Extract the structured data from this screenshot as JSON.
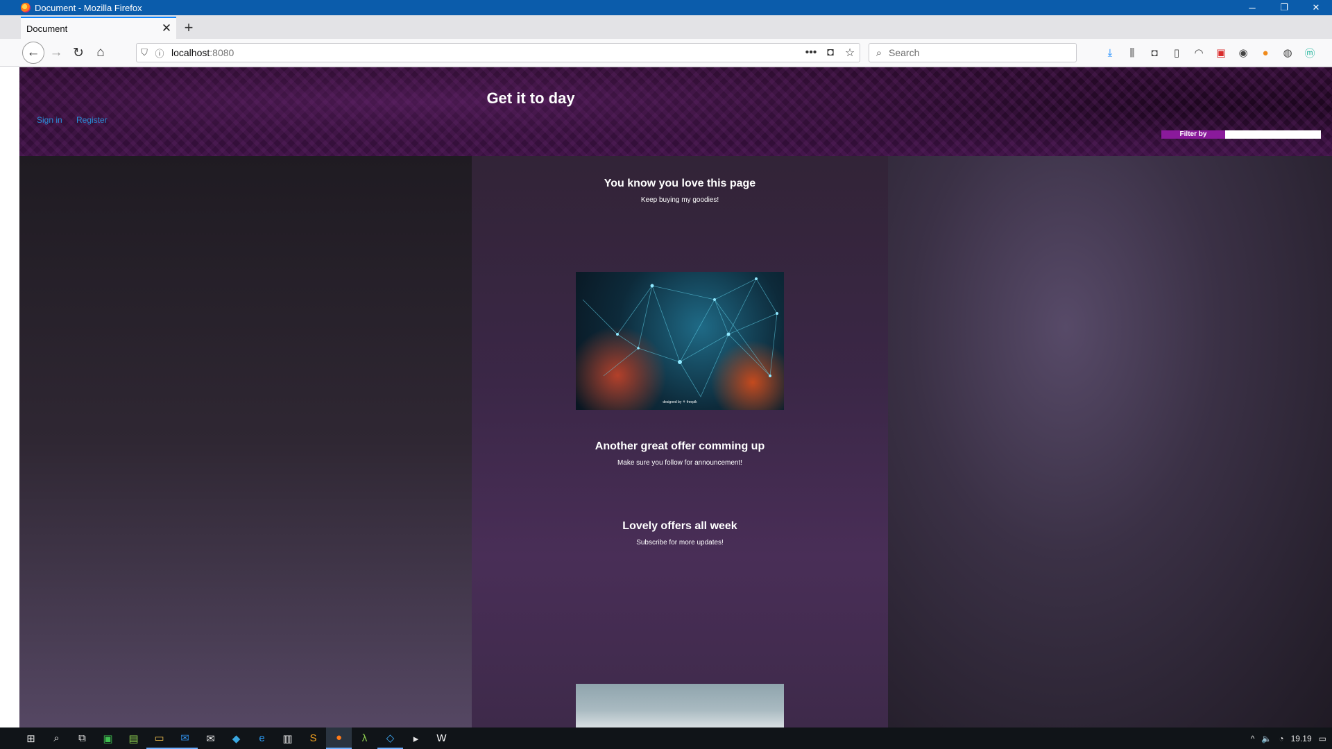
{
  "window": {
    "title": "Document - Mozilla Firefox",
    "minimize": "─",
    "restore": "❐",
    "close": "✕"
  },
  "tab": {
    "title": "Document",
    "close": "✕",
    "new_tab": "+"
  },
  "nav": {
    "back": "←",
    "forward": "→",
    "reload": "↻",
    "home": "⌂",
    "url_host": "localhost",
    "url_port": ":8080",
    "page_actions": "•••",
    "pocket": "◘",
    "bookmark": "☆",
    "search_placeholder": "Search"
  },
  "toolbar_icons": [
    "download-icon",
    "library-icon",
    "pocket-icon",
    "sidebar-icon",
    "extension-icon",
    "extension-red-icon",
    "account-icon",
    "extension-orange-icon",
    "extension-globe-icon",
    "extension-m-icon"
  ],
  "page": {
    "site_title": "Get it to day",
    "sign_in": "Sign in",
    "register": "Register",
    "filter_label": "Filter by",
    "sections": [
      {
        "title": "You know you love this page",
        "subtitle": "Keep buying my goodies!"
      },
      {
        "title": "Another great offer comming up",
        "subtitle": "Make sure you follow for announcement!"
      },
      {
        "title": "Lovely offers all week",
        "subtitle": "Subscribe for more updates!"
      }
    ],
    "image_credit": "designed by ⚘ freepik"
  },
  "colors": {
    "title_bar": "#0b5cab",
    "filter_label_bg": "#8a1a9b",
    "link": "#2a8dd6",
    "taskbar": "#101418"
  },
  "taskbar": {
    "apps": [
      "windows-start-icon",
      "search-icon",
      "task-view-icon",
      "app-green-icon",
      "photos-icon",
      "file-explorer-icon",
      "outlook-icon",
      "mail-icon",
      "store-icon",
      "edge-icon",
      "notepad-icon",
      "sublime-icon",
      "firefox-icon",
      "lambda-icon",
      "vscode-icon",
      "terminal-icon",
      "webstorm-icon"
    ],
    "clock": "19.19"
  }
}
